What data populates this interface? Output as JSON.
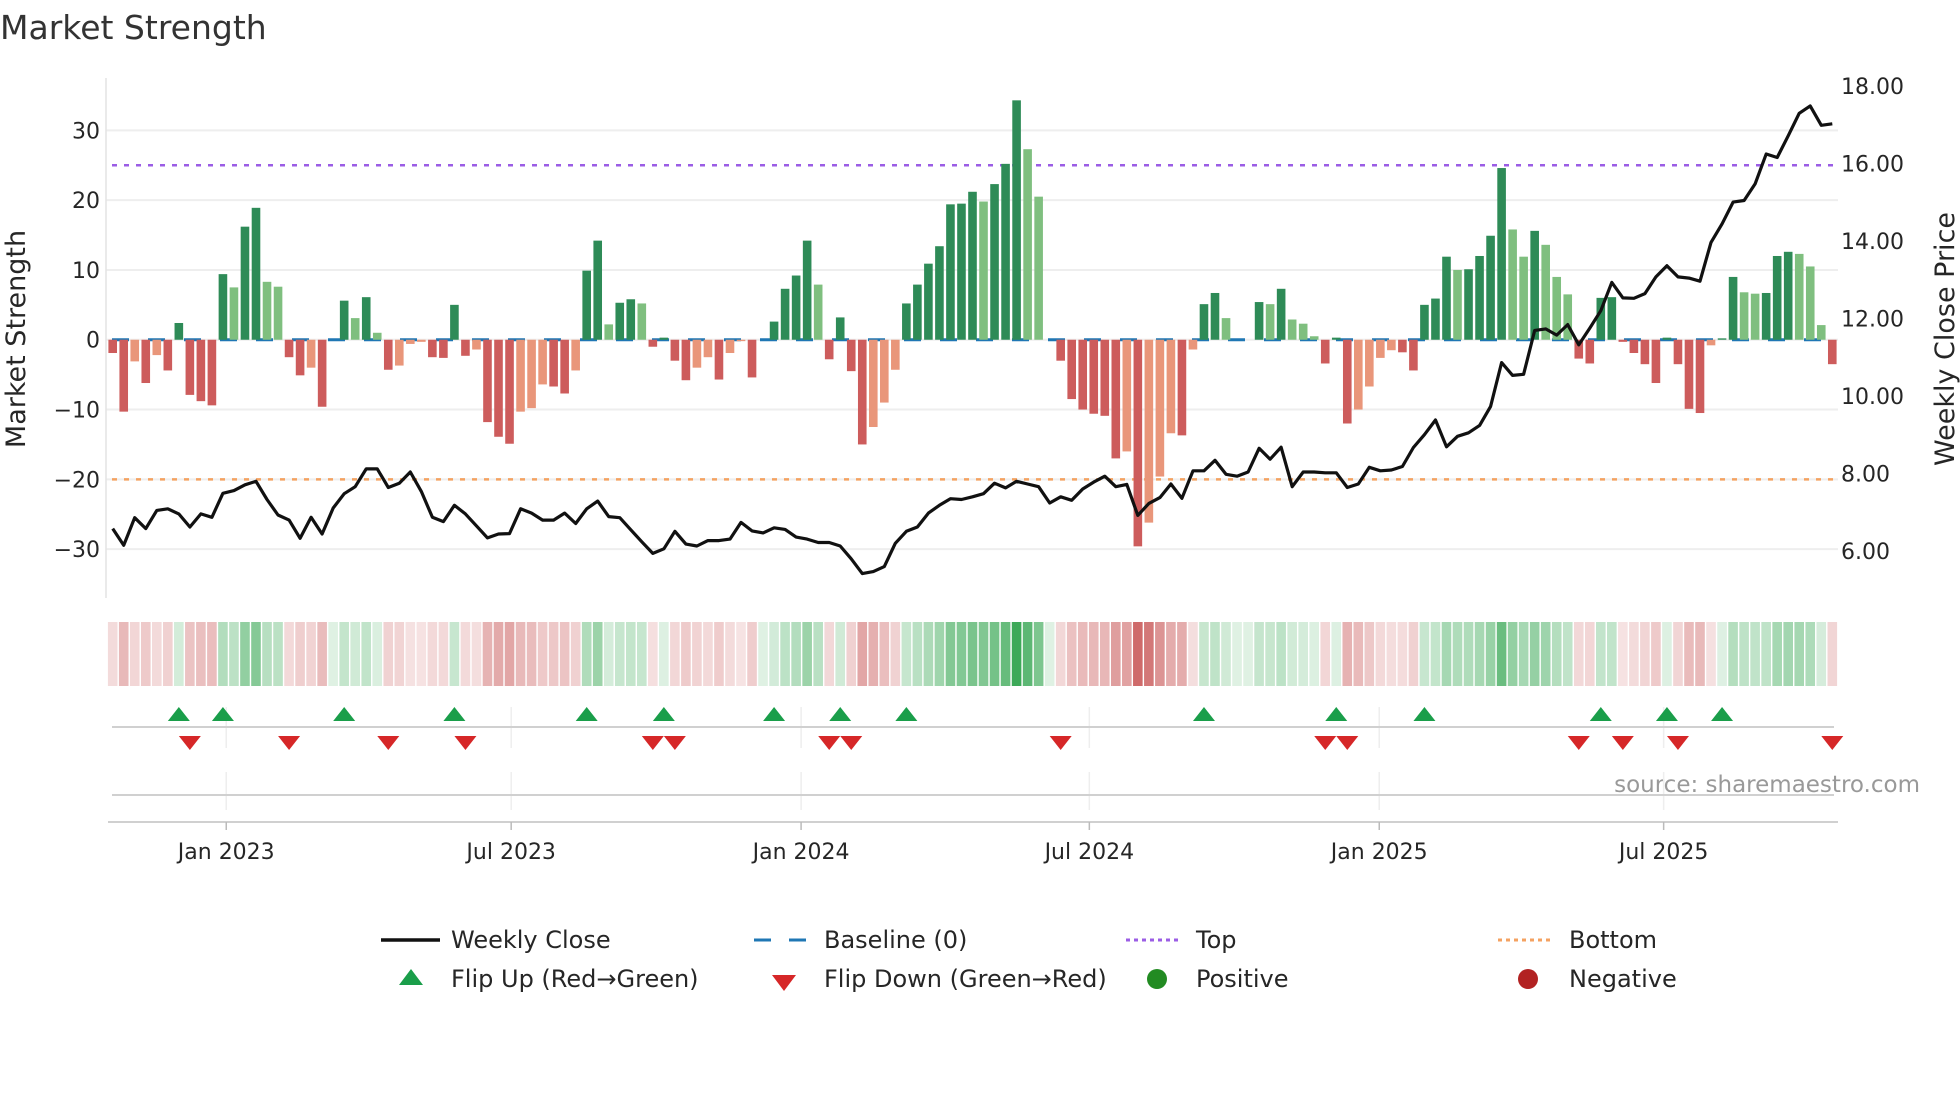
{
  "chart_data": {
    "type": "bar",
    "title": "Market Strength",
    "ylabel": "Market Strength",
    "y2label": "Weekly Close Price",
    "ylim": [
      -37,
      37.5
    ],
    "y2lim": [
      4.79,
      18.2
    ],
    "yticks": [
      30,
      20,
      10,
      0,
      -10,
      -20,
      -30
    ],
    "ytick_labels": [
      "30",
      "20",
      "10",
      "0",
      "−10",
      "−20",
      "−30"
    ],
    "y2ticks": [
      18,
      16,
      14,
      12,
      10,
      8,
      6
    ],
    "y2tick_labels": [
      "18.00",
      "16.00",
      "14.00",
      "12.00",
      "10.00",
      "8.00",
      "6.00"
    ],
    "xticks": [
      {
        "week": 10.3,
        "label": "Jan 2023"
      },
      {
        "week": 36.15,
        "label": "Jul 2023"
      },
      {
        "week": 62.45,
        "label": "Jan 2024"
      },
      {
        "week": 88.6,
        "label": "Jul 2024"
      },
      {
        "week": 114.9,
        "label": "Jan 2025"
      },
      {
        "week": 140.7,
        "label": "Jul 2025"
      }
    ],
    "top_level": 25,
    "bottom_level": -20,
    "baseline": 0,
    "strength": [
      -1.9,
      -10.3,
      -3.1,
      -6.2,
      -2.2,
      -4.4,
      2.4,
      -7.9,
      -8.8,
      -9.4,
      9.4,
      7.5,
      16.2,
      18.9,
      8.3,
      7.6,
      -2.5,
      -5.1,
      -4,
      -9.6,
      0,
      5.6,
      3.1,
      6.1,
      1,
      -4.3,
      -3.7,
      -0.6,
      -0.3,
      -2.5,
      -2.6,
      5,
      -2.3,
      -1.4,
      -11.8,
      -13.9,
      -14.9,
      -10.3,
      -9.8,
      -6.4,
      -6.7,
      -7.7,
      -4.4,
      9.9,
      14.2,
      2.2,
      5.3,
      5.8,
      5.2,
      -1,
      0.3,
      -3,
      -5.8,
      -4,
      -2.5,
      -5.7,
      -1.9,
      -0.2,
      -5.4,
      0,
      2.6,
      7.3,
      9.2,
      14.2,
      7.9,
      -2.8,
      3.2,
      -4.5,
      -15,
      -12.5,
      -9,
      -4.3,
      5.2,
      7.9,
      10.9,
      13.4,
      19.4,
      19.5,
      21.2,
      19.8,
      22.3,
      25.2,
      34.3,
      27.3,
      20.5,
      0,
      -3,
      -8.5,
      -10,
      -10.6,
      -10.9,
      -17,
      -16,
      -29.6,
      -26.2,
      -19.6,
      -13.4,
      -13.7,
      -1.4,
      5.1,
      6.7,
      3.1,
      0,
      0,
      5.4,
      5.1,
      7.3,
      2.9,
      2.3,
      0.5,
      -3.4,
      0.3,
      -12,
      -10,
      -6.7,
      -2.6,
      -1.5,
      -1.8,
      -4.4,
      5,
      5.9,
      11.9,
      10,
      10.1,
      12,
      14.9,
      24.6,
      15.8,
      11.9,
      15.6,
      13.6,
      9,
      6.5,
      -2.7,
      -3.4,
      6,
      6.1,
      -0.3,
      -1.9,
      -3.5,
      -6.2,
      0.3,
      -3.5,
      -9.9,
      -10.5,
      -0.8,
      0.2,
      9,
      6.8,
      6.6,
      6.7,
      12,
      12.6,
      12.3,
      10.5,
      2.1,
      -3.5
    ],
    "weekly_close": [
      6.58,
      6.15,
      6.86,
      6.58,
      7.05,
      7.09,
      6.96,
      6.62,
      6.96,
      6.87,
      7.49,
      7.56,
      7.71,
      7.8,
      7.33,
      6.93,
      6.8,
      6.33,
      6.87,
      6.44,
      7.11,
      7.48,
      7.66,
      8.12,
      8.12,
      7.64,
      7.75,
      8.04,
      7.54,
      6.87,
      6.76,
      7.18,
      6.96,
      6.65,
      6.34,
      6.44,
      6.45,
      7.09,
      6.98,
      6.8,
      6.8,
      6.98,
      6.71,
      7.09,
      7.29,
      6.89,
      6.86,
      6.55,
      6.24,
      5.94,
      6.06,
      6.51,
      6.18,
      6.13,
      6.27,
      6.27,
      6.31,
      6.74,
      6.52,
      6.47,
      6.6,
      6.56,
      6.36,
      6.31,
      6.22,
      6.22,
      6.13,
      5.8,
      5.42,
      5.47,
      5.6,
      6.2,
      6.51,
      6.62,
      6.98,
      7.18,
      7.35,
      7.33,
      7.4,
      7.48,
      7.75,
      7.63,
      7.8,
      7.73,
      7.66,
      7.24,
      7.4,
      7.31,
      7.6,
      7.78,
      7.93,
      7.66,
      7.72,
      6.92,
      7.23,
      7.38,
      7.73,
      7.36,
      8.07,
      8.07,
      8.34,
      7.98,
      7.93,
      8.04,
      8.65,
      8.37,
      8.68,
      7.66,
      8.04,
      8.04,
      8.02,
      8.02,
      7.64,
      7.73,
      8.16,
      8.07,
      8.09,
      8.18,
      8.67,
      9.0,
      9.38,
      8.69,
      8.96,
      9.05,
      9.24,
      9.73,
      10.86,
      10.53,
      10.56,
      11.69,
      11.73,
      11.57,
      11.84,
      11.32,
      11.75,
      12.2,
      12.93,
      12.53,
      12.52,
      12.64,
      13.07,
      13.36,
      13.07,
      13.04,
      12.96,
      13.96,
      14.44,
      15.0,
      15.04,
      15.47,
      16.24,
      16.15,
      16.71,
      17.29,
      17.48,
      16.98,
      17.02
    ],
    "flip_up_weeks": [
      6,
      10,
      21,
      31,
      43,
      50,
      60,
      66,
      72,
      99,
      111,
      119,
      135,
      141,
      146
    ],
    "flip_down_weeks": [
      7,
      16,
      25,
      32,
      49,
      51,
      65,
      67,
      86,
      110,
      112,
      133,
      137,
      142,
      156
    ],
    "legend": {
      "weekly_close": "Weekly Close",
      "baseline": "Baseline (0)",
      "top": "Top",
      "bottom": "Bottom",
      "flip_up": "Flip Up (Red→Green)",
      "flip_down": "Flip Down (Green→Red)",
      "positive": "Positive",
      "negative": "Negative"
    },
    "legend_placement": "bottom",
    "grid": true,
    "source": "source: sharemaestro.com"
  },
  "colors": {
    "pos_strong": "#2e8b57",
    "pos_weak": "#7fbf7f",
    "neg_strong": "#cd5c5c",
    "neg_weak": "#e9967a",
    "line": "#111111",
    "baseline": "#1f77b4",
    "top": "#9b5de5",
    "bottom": "#f4a261",
    "flip_up": "#1a9e4a",
    "flip_down": "#d62728",
    "positive": "#228b22",
    "negative": "#b22222"
  }
}
